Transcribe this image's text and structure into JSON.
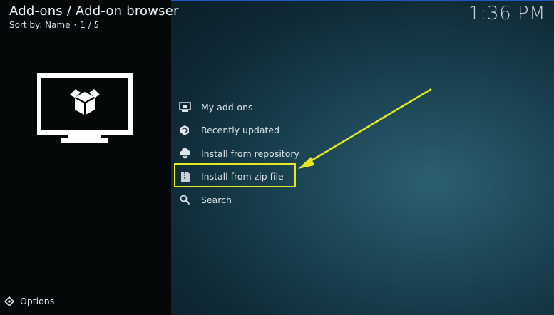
{
  "header": {
    "title": "Add-ons / Add-on browser",
    "sort_label": "Sort by: Name",
    "separator": "·",
    "page_counter": "1 / 5"
  },
  "clock": {
    "time": "1:36 PM"
  },
  "menu": {
    "items": [
      {
        "label": "My add-ons",
        "icon": "monitor-icon"
      },
      {
        "label": "Recently updated",
        "icon": "box-refresh-icon"
      },
      {
        "label": "Install from repository",
        "icon": "cloud-download-icon"
      },
      {
        "label": "Install from zip file",
        "icon": "zip-file-icon"
      },
      {
        "label": "Search",
        "icon": "search-icon"
      }
    ]
  },
  "footer": {
    "options_label": "Options",
    "icon": "options-icon"
  },
  "annotation": {
    "color": "#e4ea1f",
    "highlighted_item": "Install from zip file"
  },
  "colors": {
    "top_border": "#1f55c8",
    "left_panel": "#050809",
    "text": "#dfe6ea"
  }
}
